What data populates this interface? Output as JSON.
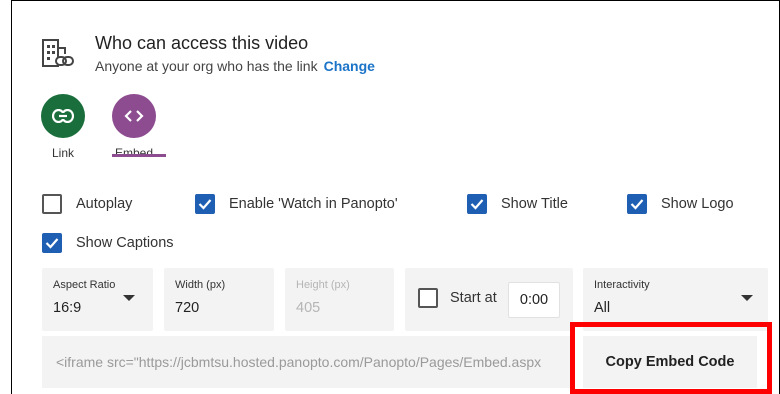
{
  "access": {
    "title": "Who can access this video",
    "description": "Anyone at your org who has the link",
    "change_label": "Change",
    "icon": "building-link-icon"
  },
  "modes": [
    {
      "label": "Link",
      "icon": "link-icon",
      "color": "#1a6e3b",
      "selected": false
    },
    {
      "label": "Embed",
      "icon": "code-brackets-icon",
      "color": "#8d4b90",
      "selected": true
    }
  ],
  "options": {
    "autoplay": {
      "label": "Autoplay",
      "checked": false
    },
    "watch_in_panopto": {
      "label": "Enable 'Watch in Panopto'",
      "checked": true
    },
    "show_title": {
      "label": "Show Title",
      "checked": true
    },
    "show_logo": {
      "label": "Show Logo",
      "checked": true
    },
    "show_captions": {
      "label": "Show Captions",
      "checked": true
    }
  },
  "fields": {
    "aspect_ratio": {
      "label": "Aspect Ratio",
      "value": "16:9"
    },
    "width": {
      "label": "Width (px)",
      "value": "720"
    },
    "height": {
      "label": "Height (px)",
      "value": "405",
      "disabled": true
    },
    "start_at": {
      "label": "Start at",
      "value": "0:00",
      "checked": false
    },
    "interactivity": {
      "label": "Interactivity",
      "value": "All"
    }
  },
  "embed": {
    "code": "<iframe src=\"https://jcbmtsu.hosted.panopto.com/Panopto/Pages/Embed.aspx",
    "copy_label": "Copy Embed Code"
  },
  "colors": {
    "accent_blue": "#1f5fb3",
    "link_blue": "#1b74c8",
    "highlight_red": "#ff0000",
    "field_bg": "#f3f3f3"
  }
}
